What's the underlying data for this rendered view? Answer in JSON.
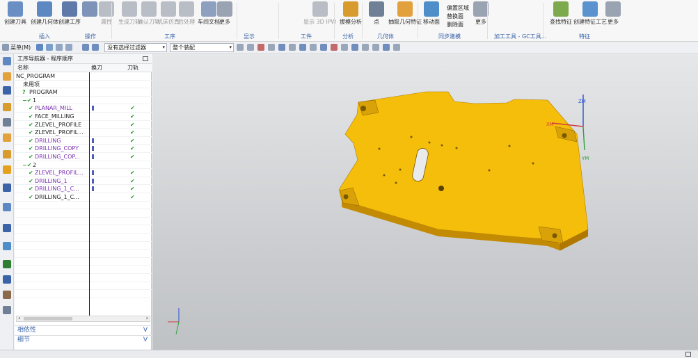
{
  "ribbon": {
    "buttons": [
      {
        "label": "创建刀具",
        "color": "#6a8fc4",
        "active": true
      },
      {
        "label": "创建几何体",
        "color": "#5e88c2"
      },
      {
        "label": "创建工序",
        "color": "#5f79a8"
      },
      {
        "label": "",
        "color": "#7d93b8"
      },
      {
        "label": "属性",
        "color": "#b9bec6",
        "dim": true
      },
      {
        "label": "生成刀轨",
        "color": "#b9bec6",
        "dim": true
      },
      {
        "label": "确认刀轨",
        "color": "#b9bec6",
        "dim": true
      },
      {
        "label": "机床仿真",
        "color": "#b9bec6",
        "dim": true
      },
      {
        "label": "后处理",
        "color": "#b9bec6",
        "dim": true
      },
      {
        "label": "车间文档",
        "color": "#8da0c0"
      },
      {
        "label": "更多",
        "color": "#9aa3b2"
      },
      {
        "label": "显示 3D IPW",
        "color": "#b9bec6",
        "dim": true
      },
      {
        "label": "拔模分析",
        "color": "#d79b2e"
      },
      {
        "label": "点",
        "color": "#6f7f95"
      },
      {
        "label": "抽取几何特征",
        "color": "#e2a13c"
      },
      {
        "label": "移动面",
        "color": "#4f8fc9"
      },
      {
        "label": "更多",
        "color": "#9aa3b2"
      },
      {
        "label": "查找特征",
        "color": "#7eaa4e"
      },
      {
        "label": "创建特征工艺",
        "color": "#5b93cf"
      },
      {
        "label": "更多",
        "color": "#9aa3b2"
      }
    ],
    "small_labels": [
      "偏置区域",
      "替换面",
      "删除面"
    ],
    "groups": [
      "插入",
      "操作",
      "工序",
      "显示",
      "工件",
      "分析",
      "几何体",
      "同步建模",
      "加工工具 - GC工具...",
      "特征"
    ]
  },
  "toolbar2": {
    "menu_label": "菜单(M)",
    "filter_value": "没有选择过滤器",
    "assembly_value": "整个装配"
  },
  "navigator": {
    "title": "工序导航器 - 程序顺序",
    "columns": {
      "name": "名称",
      "tool_change": "换刀",
      "toolpath": "刀轨"
    },
    "rows": [
      {
        "text": "NC_PROGRAM",
        "indent": 0,
        "type": "root",
        "prefix": "",
        "tchg": false,
        "tpath": false
      },
      {
        "text": "未用项",
        "indent": 1,
        "type": "folder",
        "prefix": "",
        "tchg": false,
        "tpath": false
      },
      {
        "text": "PROGRAM",
        "indent": 1,
        "type": "folder",
        "prefix": "?",
        "tchg": false,
        "tpath": false
      },
      {
        "text": "1",
        "indent": 1,
        "type": "group",
        "prefix": "−✔",
        "tchg": false,
        "tpath": false
      },
      {
        "text": "PLANAR_MILL",
        "indent": 2,
        "type": "op",
        "prefix": "✔",
        "tchg": true,
        "tpath": true
      },
      {
        "text": "FACE_MILLING",
        "indent": 2,
        "type": "plain",
        "prefix": "✔",
        "tchg": false,
        "tpath": true
      },
      {
        "text": "ZLEVEL_PROFILE",
        "indent": 2,
        "type": "plain",
        "prefix": "✔",
        "tchg": false,
        "tpath": true
      },
      {
        "text": "ZLEVEL_PROFIL...",
        "indent": 2,
        "type": "plain",
        "prefix": "✔",
        "tchg": false,
        "tpath": true
      },
      {
        "text": "DRILLING",
        "indent": 2,
        "type": "op",
        "prefix": "✔",
        "tchg": true,
        "tpath": true
      },
      {
        "text": "DRILLING_COPY",
        "indent": 2,
        "type": "op",
        "prefix": "✔",
        "tchg": true,
        "tpath": true
      },
      {
        "text": "DRILLING_COP...",
        "indent": 2,
        "type": "op",
        "prefix": "✔",
        "tchg": true,
        "tpath": true
      },
      {
        "text": "2",
        "indent": 1,
        "type": "group",
        "prefix": "−✔",
        "tchg": false,
        "tpath": false
      },
      {
        "text": "ZLEVEL_PROFIL...",
        "indent": 2,
        "type": "op",
        "prefix": "✔",
        "tchg": true,
        "tpath": true
      },
      {
        "text": "DRILLING_1",
        "indent": 2,
        "type": "op",
        "prefix": "✔",
        "tchg": true,
        "tpath": true
      },
      {
        "text": "DRILLING_1_C...",
        "indent": 2,
        "type": "op",
        "prefix": "✔",
        "tchg": true,
        "tpath": true
      },
      {
        "text": "DRILLING_1_C...",
        "indent": 2,
        "type": "plain",
        "prefix": "✔",
        "tchg": false,
        "tpath": true
      }
    ],
    "panels": {
      "dependencies": "相依性",
      "details": "细节"
    }
  },
  "viewport": {
    "axis_labels": {
      "zm": "ZM",
      "xm": "XM",
      "ym": "YM"
    },
    "part_color": "#f5be0b"
  }
}
